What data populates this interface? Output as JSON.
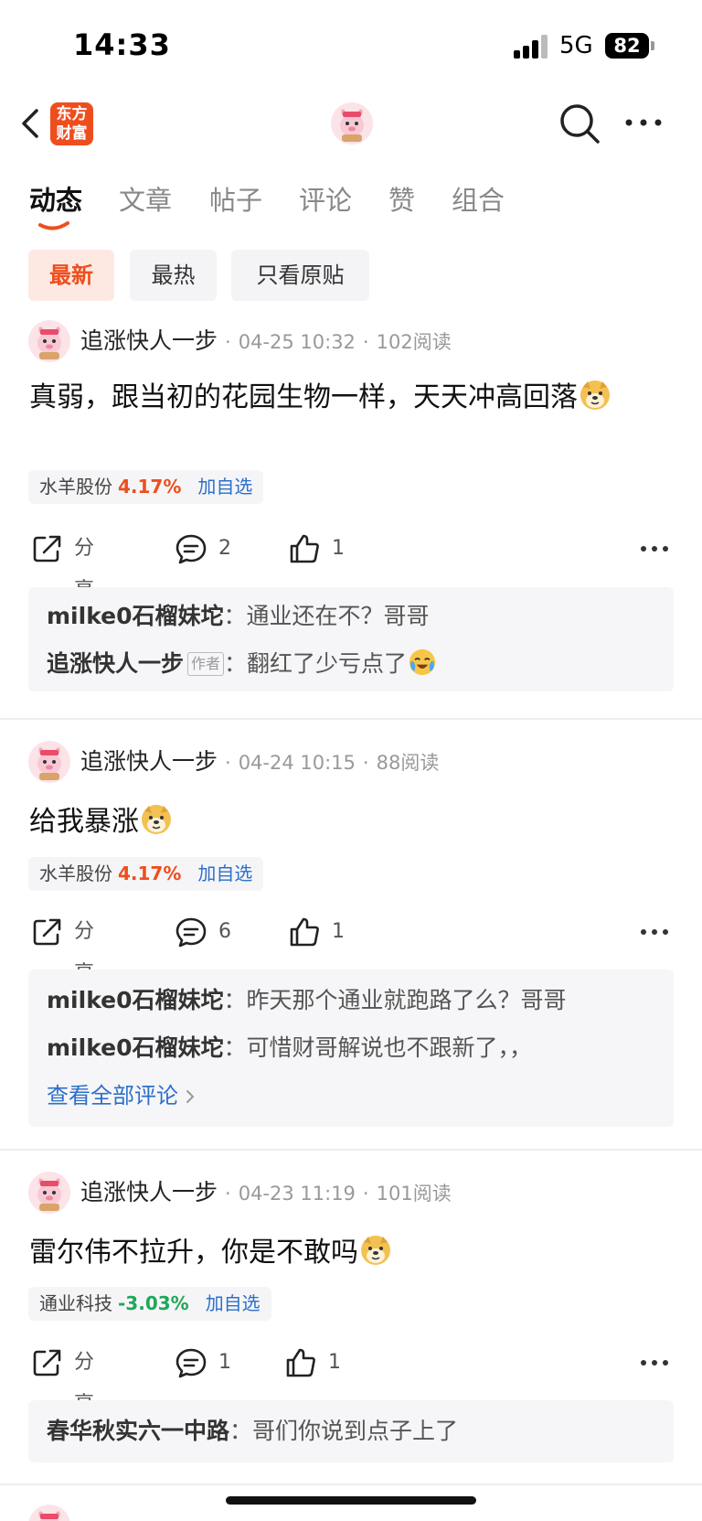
{
  "status_bar": {
    "time": "14:33",
    "network": "5G",
    "battery": "82"
  },
  "header": {
    "logo_line1": "东方",
    "logo_line2": "财富"
  },
  "tabs": [
    {
      "label": "动态",
      "active": true
    },
    {
      "label": "文章"
    },
    {
      "label": "帖子"
    },
    {
      "label": "评论"
    },
    {
      "label": "赞"
    },
    {
      "label": "组合"
    }
  ],
  "filters": [
    {
      "label": "最新",
      "active": true
    },
    {
      "label": "最热"
    },
    {
      "label": "只看原贴"
    }
  ],
  "posts": [
    {
      "author": "追涨快人一步",
      "date": "04-25 10:32",
      "reads": "102阅读",
      "content": "真弱，跟当初的花园生物一样，天天冲高回落",
      "stock": {
        "name": "水羊股份",
        "change": "4.17%",
        "direction": "up",
        "add_label": "加自选"
      },
      "share_label": "分享",
      "comment_count": "2",
      "like_count": "1",
      "comments": [
        {
          "name": "milke0石榴妹坨",
          "sep": "：",
          "text": "通业还在不？哥哥"
        },
        {
          "name": "追涨快人一步",
          "author_tag": "作者",
          "sep": "：",
          "text": "翻红了少亏点了"
        }
      ]
    },
    {
      "author": "追涨快人一步",
      "date": "04-24 10:15",
      "reads": "88阅读",
      "content": "给我暴涨",
      "stock": {
        "name": "水羊股份",
        "change": "4.17%",
        "direction": "up",
        "add_label": "加自选"
      },
      "share_label": "分享",
      "comment_count": "6",
      "like_count": "1",
      "comments": [
        {
          "name": "milke0石榴妹坨",
          "sep": "：",
          "text": "昨天那个通业就跑路了么？哥哥"
        },
        {
          "name": "milke0石榴妹坨",
          "sep": "：",
          "text": "可惜财哥解说也不跟新了，，"
        }
      ],
      "view_all": "查看全部评论"
    },
    {
      "author": "追涨快人一步",
      "date": "04-23 11:19",
      "reads": "101阅读",
      "content": "雷尔伟不拉升，你是不敢吗",
      "stock": {
        "name": "通业科技",
        "change": "-3.03%",
        "direction": "down",
        "add_label": "加自选"
      },
      "share_label": "分享",
      "comment_count": "1",
      "like_count": "1",
      "comments": [
        {
          "name": "春华秋实六一中路",
          "sep": "：",
          "text": "哥们你说到点子上了"
        }
      ]
    }
  ],
  "colors": {
    "brand": "#ee4e1e",
    "up": "#ee4e1e",
    "down": "#1fa859",
    "link": "#2c6fc9"
  }
}
